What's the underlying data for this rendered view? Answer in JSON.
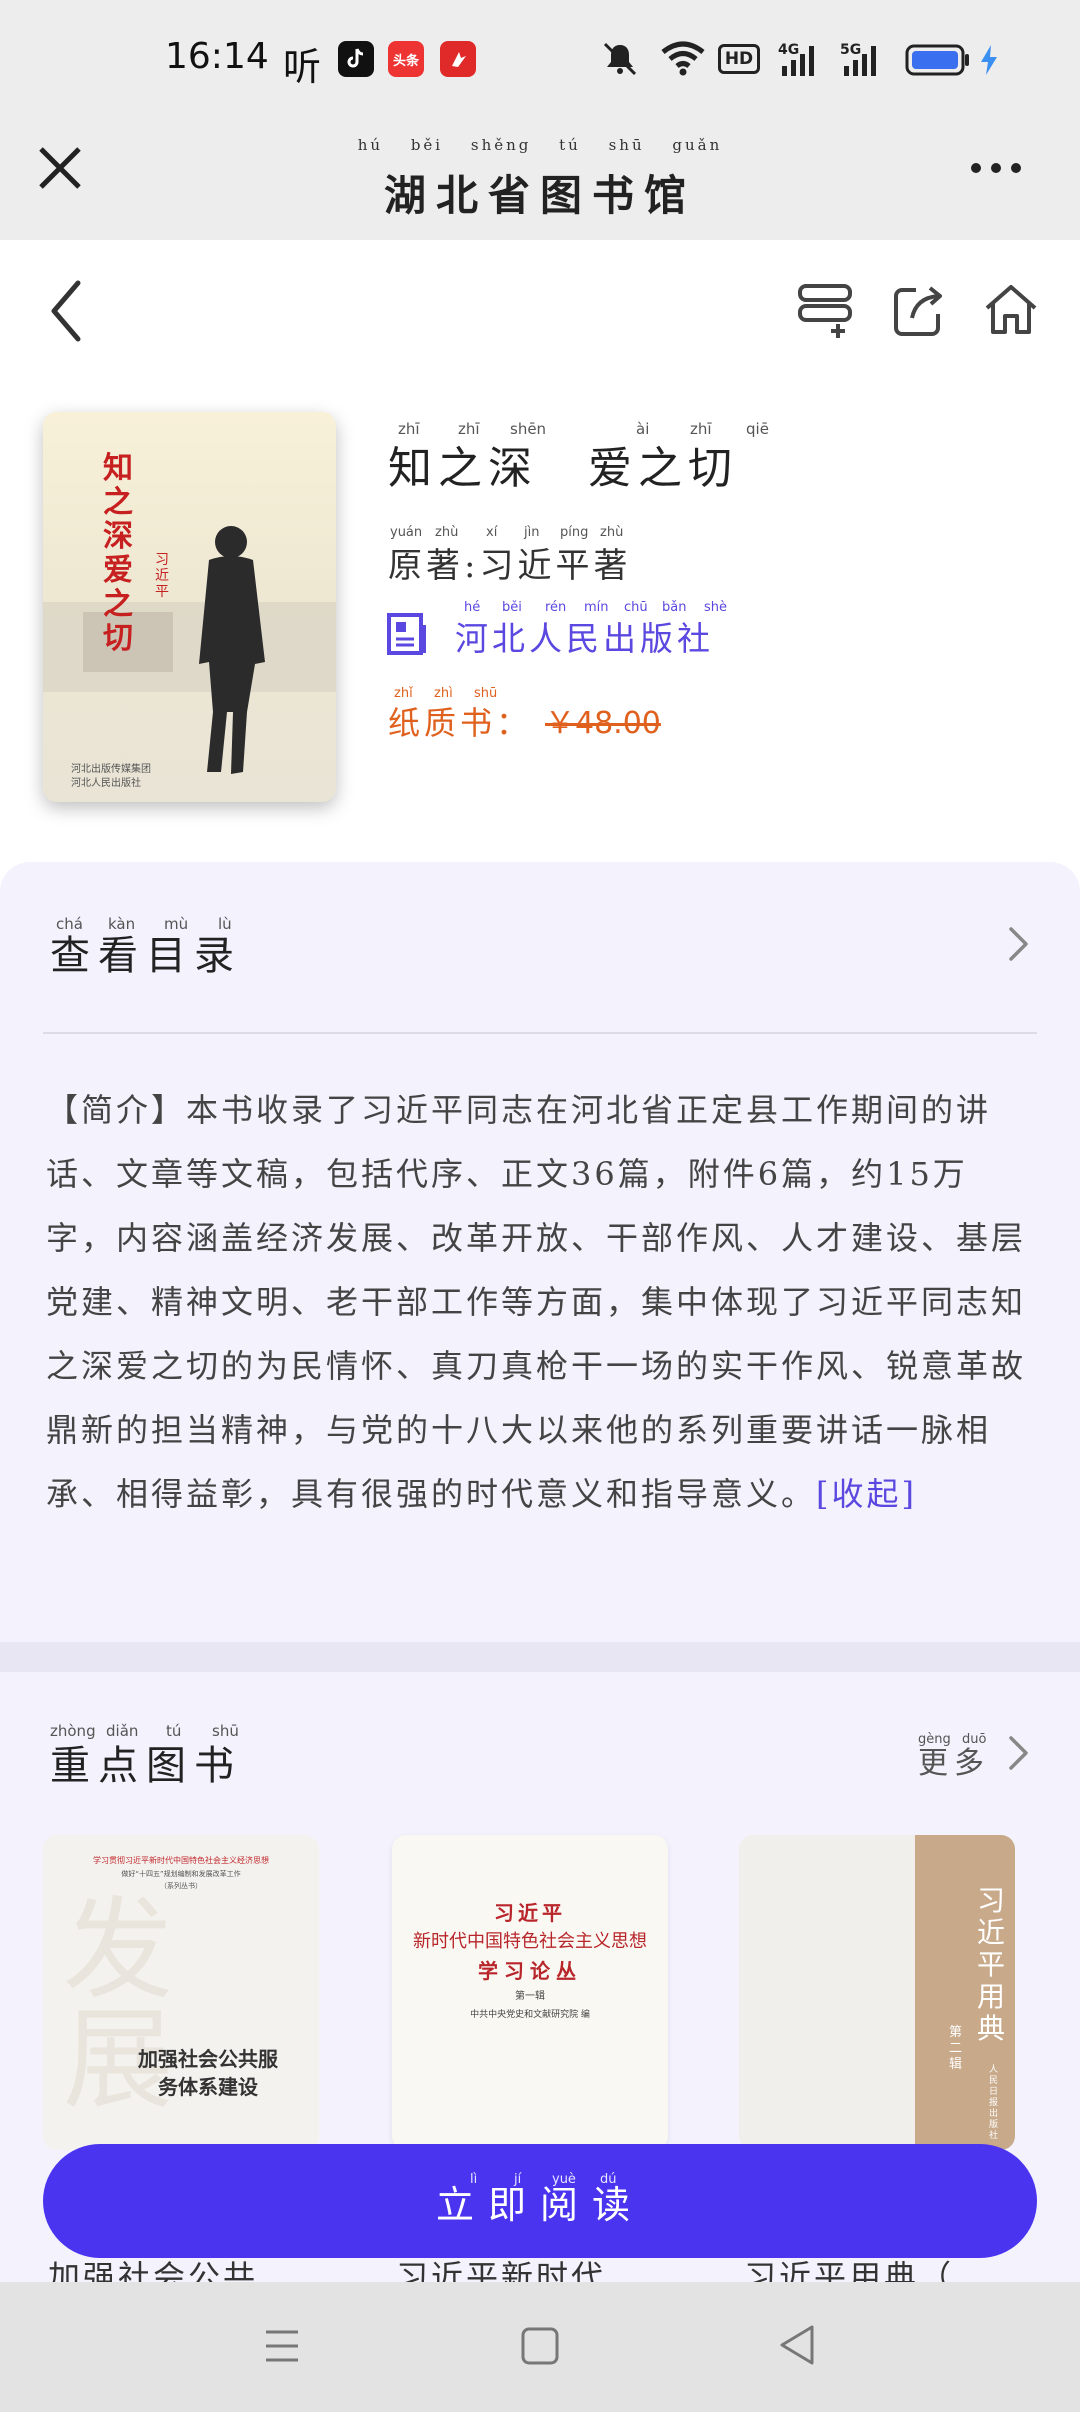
{
  "status_bar": {
    "time": "16:14",
    "app_icons": [
      "听",
      "抖音",
      "头条",
      "app-red"
    ],
    "right_icons": [
      "mute-icon",
      "wifi-icon",
      "hd-icon",
      "4g-signal-icon",
      "5g-signal-icon",
      "battery-icon",
      "charging-icon"
    ],
    "hd": "HD",
    "net_4g": "4G",
    "net_5g": "5G",
    "ting": "听",
    "toutiao": "头条"
  },
  "title_bar": {
    "title": "湖北省图书馆",
    "title_pinyin": "hú běi shěng tú shū guǎn"
  },
  "book": {
    "title": "知之深　爱之切",
    "title_pinyin": [
      "zhī",
      "zhī",
      "shēn",
      "ài",
      "zhī",
      "qiē"
    ],
    "author": "原著:习近平著",
    "author_pinyin": [
      "yuán",
      "zhù",
      "xí",
      "jìn",
      "píng",
      "zhù"
    ],
    "publisher": "河北人民出版社",
    "publisher_pinyin": [
      "hé",
      "běi",
      "rén",
      "mín",
      "chū",
      "bǎn",
      "shè"
    ],
    "price_label": "纸质书：",
    "price_label_pinyin": [
      "zhǐ",
      "zhì",
      "shū"
    ],
    "price": "￥48.00",
    "cover": {
      "title": "知之深 爱之切",
      "author": "习近平",
      "publisher_line1": "河北出版传媒集团",
      "publisher_line2": "河北人民出版社"
    }
  },
  "toc": {
    "label": "查看目录",
    "label_pinyin": [
      "chá",
      "kàn",
      "mù",
      "lù"
    ]
  },
  "intro": {
    "text": "【简介】本书收录了习近平同志在河北省正定县工作期间的讲话、文章等文稿，包括代序、正文36篇，附件6篇，约15万字，内容涵盖经济发展、改革开放、干部作风、人才建设、基层党建、精神文明、老干部工作等方面，集中体现了习近平同志知之深爱之切的为民情怀、真刀真枪干一场的实干作风、锐意革故鼎新的担当精神，与党的十八大以来他的系列重要讲话一脉相承、相得益彰，具有很强的时代意义和指导意义。",
    "collapse": "[收起]"
  },
  "featured": {
    "title": "重点图书",
    "title_pinyin": [
      "zhòng",
      "diǎn",
      "tú",
      "shū"
    ],
    "more": "更多",
    "more_pinyin": [
      "gèng",
      "duō"
    ],
    "books": [
      {
        "name": "加强社会公共…",
        "cover_top": "学习贯彻习近平新时代中国特色社会主义经济思想",
        "cover_sub": "做好“十四五”规划编制和发展改革工作",
        "cover_series": "（系列丛书）",
        "cover_title": "加强社会公共服务体系建设"
      },
      {
        "name": "习近平新时代…",
        "cover_line1": "习近平",
        "cover_line2": "新时代中国特色社会主义思想",
        "cover_line3": "学习论丛",
        "cover_line4": "第一辑",
        "cover_line5": "中共中央党史和文献研究院 编"
      },
      {
        "name": "习近平用典（…",
        "cover_title": "习近平用典",
        "cover_sub": "第二辑",
        "cover_pub": "人民日报出版社"
      }
    ]
  },
  "read_button": {
    "label": "立即阅读",
    "pinyin": [
      "lì",
      "jí",
      "yuè",
      "dú"
    ]
  },
  "nav": [
    "menu-icon",
    "home-square-icon",
    "back-triangle-icon"
  ],
  "colors": {
    "accent": "#4a34f0",
    "publisher": "#5a48e0",
    "price": "#e0601e",
    "panel_bg": "#f3f2fd"
  }
}
